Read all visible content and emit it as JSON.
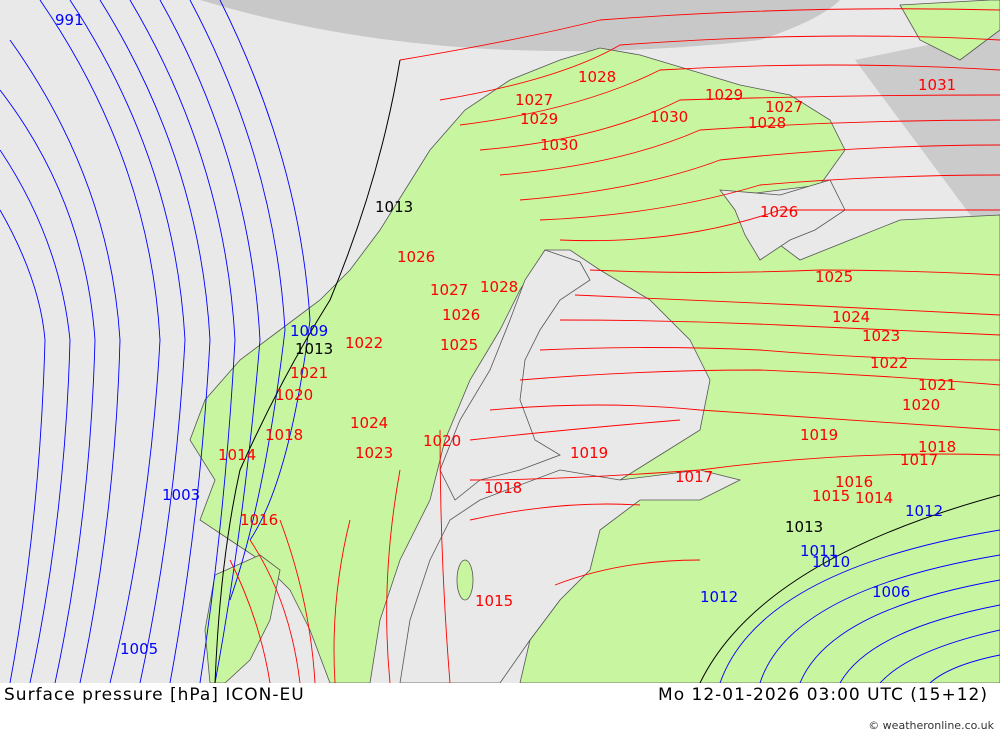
{
  "footer": {
    "title": "Surface pressure [hPa] ICON-EU",
    "datetime": "Mo 12-01-2026 03:00 UTC (15+12)",
    "credit": "© weatheronline.co.uk"
  },
  "colors": {
    "land": "#c8f5a0",
    "sea": "#e9e9e9",
    "no_data": "#c8c8c8",
    "low_pressure_line": "#0000ff",
    "high_pressure_line": "#ff0000",
    "reference_line": "#000000"
  },
  "isobar_labels": [
    {
      "text": "991",
      "kind": "low"
    },
    {
      "text": "1013",
      "kind": "ref"
    },
    {
      "text": "1009",
      "kind": "low"
    },
    {
      "text": "1013",
      "kind": "ref"
    },
    {
      "text": "1005",
      "kind": "low"
    },
    {
      "text": "1003",
      "kind": "low"
    },
    {
      "text": "1014",
      "kind": "high"
    },
    {
      "text": "1016",
      "kind": "high"
    },
    {
      "text": "1018",
      "kind": "high"
    },
    {
      "text": "1020",
      "kind": "high"
    },
    {
      "text": "1021",
      "kind": "high"
    },
    {
      "text": "1022",
      "kind": "high"
    },
    {
      "text": "1023",
      "kind": "high"
    },
    {
      "text": "1024",
      "kind": "high"
    },
    {
      "text": "1025",
      "kind": "high"
    },
    {
      "text": "1026",
      "kind": "high"
    },
    {
      "text": "1027",
      "kind": "high"
    },
    {
      "text": "1028",
      "kind": "high"
    },
    {
      "text": "1029",
      "kind": "high"
    },
    {
      "text": "1030",
      "kind": "high"
    },
    {
      "text": "1031",
      "kind": "high"
    },
    {
      "text": "1026",
      "kind": "high"
    },
    {
      "text": "1027",
      "kind": "high"
    },
    {
      "text": "1028",
      "kind": "high"
    },
    {
      "text": "1029",
      "kind": "high"
    },
    {
      "text": "1030",
      "kind": "high"
    },
    {
      "text": "1028",
      "kind": "high"
    },
    {
      "text": "1027",
      "kind": "high"
    },
    {
      "text": "1026",
      "kind": "high"
    },
    {
      "text": "1025",
      "kind": "high"
    },
    {
      "text": "1024",
      "kind": "high"
    },
    {
      "text": "1023",
      "kind": "high"
    },
    {
      "text": "1022",
      "kind": "high"
    },
    {
      "text": "1021",
      "kind": "high"
    },
    {
      "text": "1020",
      "kind": "high"
    },
    {
      "text": "1019",
      "kind": "high"
    },
    {
      "text": "1018",
      "kind": "high"
    },
    {
      "text": "1017",
      "kind": "high"
    },
    {
      "text": "1016",
      "kind": "high"
    },
    {
      "text": "1015",
      "kind": "high"
    },
    {
      "text": "1014",
      "kind": "high"
    },
    {
      "text": "1013",
      "kind": "ref"
    },
    {
      "text": "1012",
      "kind": "low"
    },
    {
      "text": "1011",
      "kind": "low"
    },
    {
      "text": "1010",
      "kind": "low"
    },
    {
      "text": "1006",
      "kind": "low"
    },
    {
      "text": "1012",
      "kind": "low"
    },
    {
      "text": "1015",
      "kind": "high"
    },
    {
      "text": "1020",
      "kind": "high"
    },
    {
      "text": "1019",
      "kind": "high"
    },
    {
      "text": "1017",
      "kind": "high"
    },
    {
      "text": "1018",
      "kind": "high"
    }
  ]
}
